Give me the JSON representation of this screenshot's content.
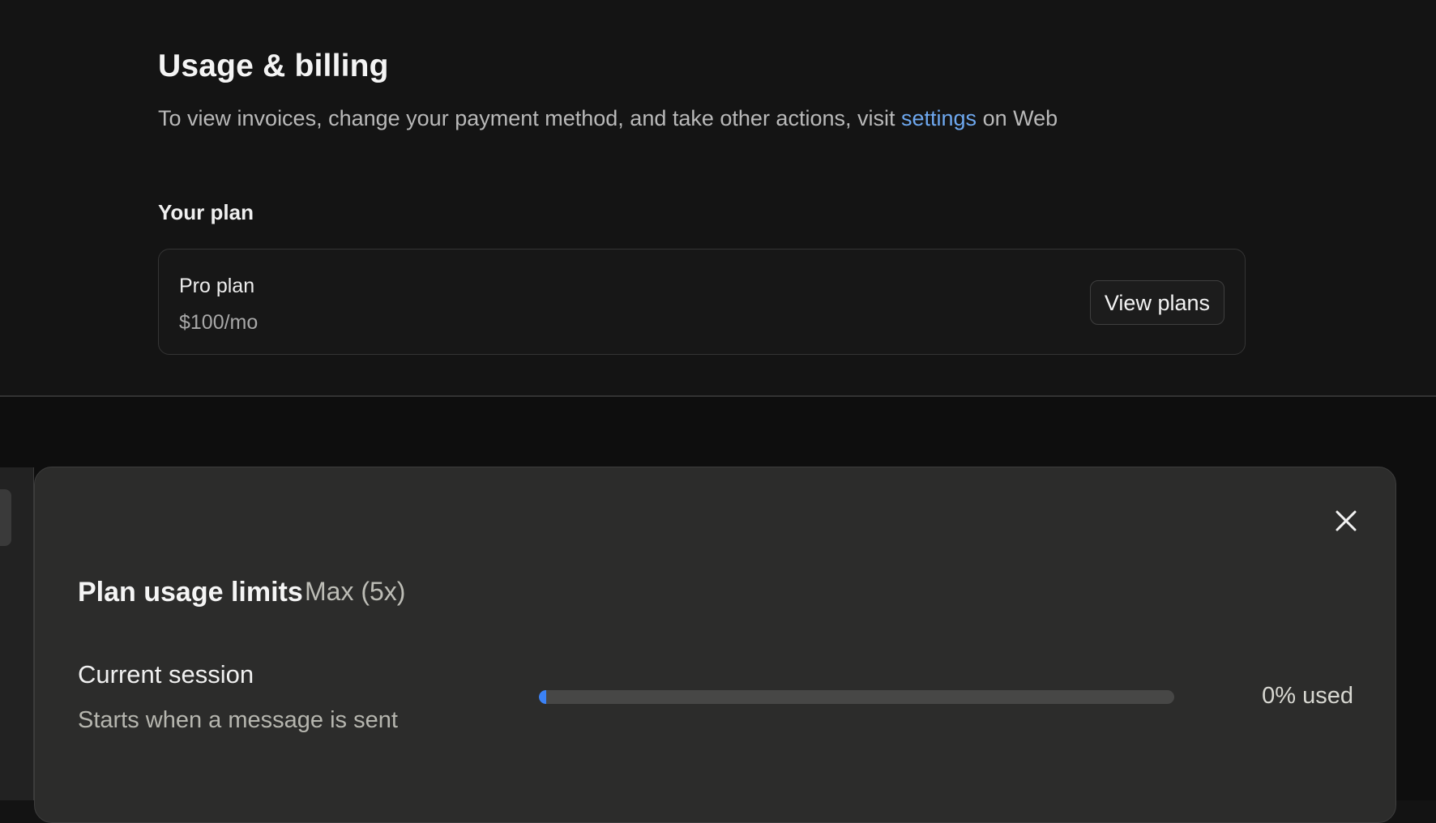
{
  "page": {
    "title": "Usage & billing",
    "description_prefix": "To view invoices, change your payment method, and take other actions, visit ",
    "description_link": "settings",
    "description_suffix": " on Web"
  },
  "plan_section": {
    "label": "Your plan",
    "plan_name": "Pro plan",
    "plan_price": "$100/mo",
    "view_plans_label": "View plans"
  },
  "usage_modal": {
    "title": "Plan usage limits",
    "tier": "Max (5x)",
    "close_icon": "close-icon",
    "current_session": {
      "title": "Current session",
      "subtitle": "Starts when a message is sent",
      "progress_percent": 0,
      "usage_label": "0% used"
    }
  },
  "colors": {
    "link": "#6ea8ef",
    "progress_fill": "#3b82f6",
    "modal_bg": "#2c2c2b",
    "page_bg": "#141414"
  }
}
